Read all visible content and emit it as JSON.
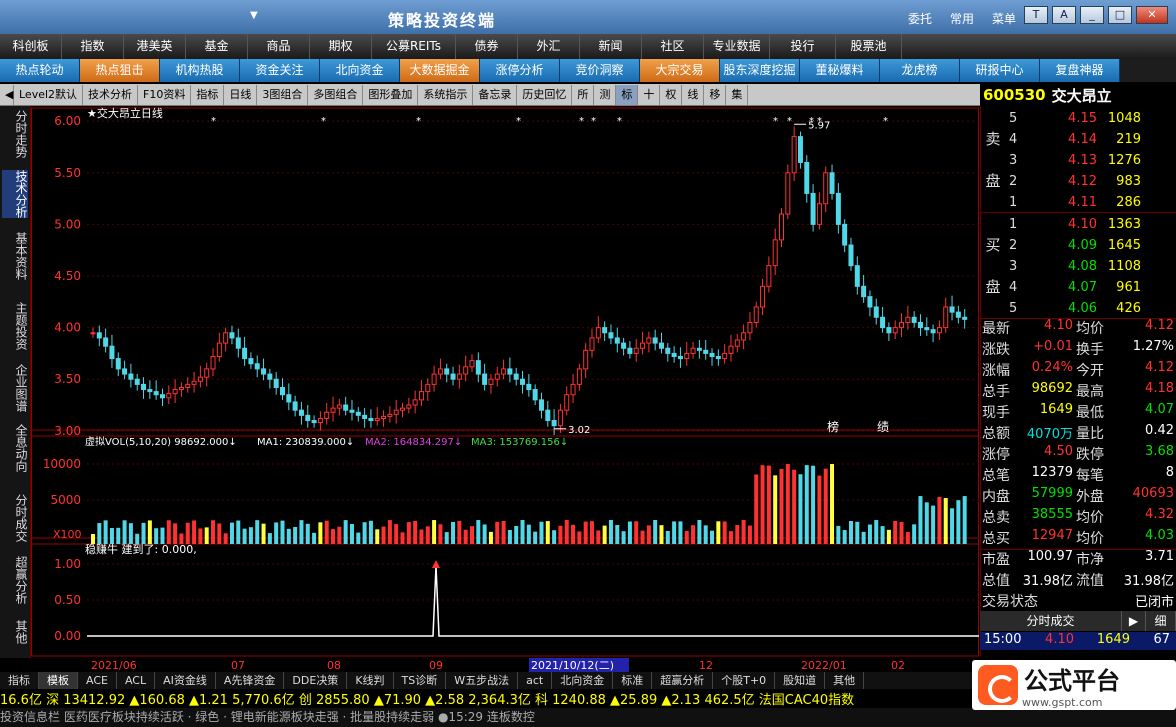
{
  "title": "策略投资终端",
  "titlebar_links": [
    "委托",
    "常用",
    "菜单"
  ],
  "menu1": [
    "科创板",
    "指数",
    "港美英",
    "基金",
    "商品",
    "期权",
    "公募REITs",
    "债券",
    "外汇",
    "新闻",
    "社区",
    "专业数据",
    "投行",
    "股票池"
  ],
  "menu2": [
    {
      "label": "热点轮动",
      "style": "blue"
    },
    {
      "label": "热点狙击",
      "style": "orange"
    },
    {
      "label": "机构热股",
      "style": "blue"
    },
    {
      "label": "资金关注",
      "style": "blue"
    },
    {
      "label": "北向资金",
      "style": "blue"
    },
    {
      "label": "大数据掘金",
      "style": "orange"
    },
    {
      "label": "涨停分析",
      "style": "blue"
    },
    {
      "label": "竞价洞察",
      "style": "blue"
    },
    {
      "label": "大宗交易",
      "style": "orange"
    },
    {
      "label": "股东深度挖掘",
      "style": "blue"
    },
    {
      "label": "董秘爆料",
      "style": "blue"
    },
    {
      "label": "龙虎榜",
      "style": "blue"
    },
    {
      "label": "研报中心",
      "style": "blue"
    },
    {
      "label": "复盘神器",
      "style": "blue"
    }
  ],
  "toolbar": [
    "Level2默认",
    "技术分析",
    "F10资料",
    "指标",
    "日线",
    "3图组合",
    "多图组合",
    "图形叠加",
    "系统指示",
    "备忘录",
    "历史回忆",
    "所",
    "测",
    "标",
    "十",
    "权",
    "线",
    "移",
    "集"
  ],
  "stock": {
    "code": "600530",
    "name": "交大昂立"
  },
  "left_tabs": [
    "分时走势",
    "技术分析",
    "基本资料",
    "主题投资",
    "企业图谱",
    "全息动向",
    "分时成交",
    "超赢分析",
    "其他"
  ],
  "chart_data": {
    "type": "candlestick",
    "title": "交大昂立日线",
    "y_ticks": [
      "6.00",
      "5.50",
      "5.00",
      "4.50",
      "4.00",
      "3.50",
      "3.00"
    ],
    "ylim": [
      2.95,
      6.05
    ],
    "high_label": "5.97",
    "low_label": "3.02",
    "annotations": [
      "榜",
      "绩"
    ],
    "closes": [
      3.95,
      3.9,
      3.82,
      3.7,
      3.6,
      3.55,
      3.5,
      3.45,
      3.4,
      3.38,
      3.35,
      3.32,
      3.36,
      3.4,
      3.42,
      3.45,
      3.48,
      3.52,
      3.6,
      3.72,
      3.85,
      3.95,
      3.9,
      3.8,
      3.7,
      3.65,
      3.6,
      3.55,
      3.5,
      3.42,
      3.35,
      3.28,
      3.2,
      3.15,
      3.1,
      3.08,
      3.12,
      3.18,
      3.22,
      3.25,
      3.2,
      3.18,
      3.15,
      3.12,
      3.1,
      3.12,
      3.14,
      3.16,
      3.2,
      3.22,
      3.25,
      3.3,
      3.38,
      3.45,
      3.55,
      3.6,
      3.55,
      3.5,
      3.55,
      3.62,
      3.68,
      3.55,
      3.45,
      3.5,
      3.55,
      3.6,
      3.55,
      3.5,
      3.45,
      3.4,
      3.3,
      3.2,
      3.1,
      3.05,
      3.2,
      3.35,
      3.45,
      3.6,
      3.78,
      3.9,
      4.0,
      3.95,
      3.9,
      3.85,
      3.8,
      3.75,
      3.8,
      3.85,
      3.9,
      3.85,
      3.8,
      3.75,
      3.72,
      3.7,
      3.75,
      3.8,
      3.78,
      3.75,
      3.72,
      3.7,
      3.75,
      3.82,
      3.88,
      3.95,
      4.05,
      4.2,
      4.4,
      4.6,
      4.85,
      5.1,
      5.5,
      5.85,
      5.6,
      5.3,
      5.0,
      5.2,
      5.5,
      5.3,
      5.0,
      4.8,
      4.6,
      4.4,
      4.3,
      4.2,
      4.1,
      4.0,
      3.95,
      4.0,
      4.05,
      4.1,
      4.05,
      4.0,
      3.98,
      3.95,
      4.0,
      4.2,
      4.15,
      4.1,
      4.08
    ],
    "indicator_vol": {
      "label": "虚拟VOL(5,10,20)",
      "value": "98692.000",
      "ma1_label": "MA1:",
      "ma1": "230839.000",
      "ma2_label": "MA2:",
      "ma2": "164834.297",
      "ma3_label": "MA3:",
      "ma3": "153769.156",
      "y_ticks": [
        "10000",
        "5000"
      ],
      "unit": "X100"
    },
    "indicator_ai": {
      "label": "稳赚牛",
      "text": "建到了: 0.000,",
      "y_ticks": [
        "1.00",
        "0.50",
        "0.00"
      ]
    },
    "date_labels": [
      "2021/06",
      "07",
      "08",
      "09",
      "2021/10/12(二)",
      "12",
      "2022/01",
      "02"
    ]
  },
  "orderbook": {
    "sell": [
      {
        "lv": "5",
        "price": "4.15",
        "vol": "1048"
      },
      {
        "lv": "4",
        "price": "4.14",
        "vol": "219"
      },
      {
        "lv": "3",
        "price": "4.13",
        "vol": "1276"
      },
      {
        "lv": "2",
        "price": "4.12",
        "vol": "983"
      },
      {
        "lv": "1",
        "price": "4.11",
        "vol": "286"
      }
    ],
    "buy": [
      {
        "lv": "1",
        "price": "4.10",
        "vol": "1363"
      },
      {
        "lv": "2",
        "price": "4.09",
        "vol": "1645"
      },
      {
        "lv": "3",
        "price": "4.08",
        "vol": "1108"
      },
      {
        "lv": "4",
        "price": "4.07",
        "vol": "961"
      },
      {
        "lv": "5",
        "price": "4.06",
        "vol": "426"
      }
    ],
    "sell_label": [
      "卖",
      "盘"
    ],
    "buy_label": [
      "买",
      "盘"
    ]
  },
  "info": [
    {
      "l1": "最新",
      "v1": "4.10",
      "c1": "red",
      "l2": "均价",
      "v2": "4.12",
      "c2": "red"
    },
    {
      "l1": "涨跌",
      "v1": "+0.01",
      "c1": "red",
      "l2": "换手",
      "v2": "1.27%",
      "c2": "white"
    },
    {
      "l1": "涨幅",
      "v1": "0.24%",
      "c1": "red",
      "l2": "今开",
      "v2": "4.12",
      "c2": "red"
    },
    {
      "l1": "总手",
      "v1": "98692",
      "c1": "yellow",
      "l2": "最高",
      "v2": "4.18",
      "c2": "red"
    },
    {
      "l1": "现手",
      "v1": "1649",
      "c1": "yellow",
      "l2": "最低",
      "v2": "4.07",
      "c2": "green"
    },
    {
      "l1": "总额",
      "v1": "4070万",
      "c1": "cyan",
      "l2": "量比",
      "v2": "0.42",
      "c2": "white"
    },
    {
      "l1": "涨停",
      "v1": "4.50",
      "c1": "red",
      "l2": "跌停",
      "v2": "3.68",
      "c2": "green"
    },
    {
      "l1": "总笔",
      "v1": "12379",
      "c1": "white",
      "l2": "每笔",
      "v2": "8",
      "c2": "white"
    },
    {
      "l1": "内盘",
      "v1": "57999",
      "c1": "green",
      "l2": "外盘",
      "v2": "40693",
      "c2": "red"
    },
    {
      "l1": "总卖",
      "v1": "38555",
      "c1": "green",
      "l2": "均价",
      "v2": "4.32",
      "c2": "red"
    },
    {
      "l1": "总买",
      "v1": "12947",
      "c1": "red",
      "l2": "均价",
      "v2": "4.03",
      "c2": "green"
    },
    {
      "l1": "市盈",
      "v1": "100.97",
      "c1": "white",
      "l2": "市净",
      "v2": "3.71",
      "c2": "white"
    },
    {
      "l1": "总值",
      "v1": "31.98亿",
      "c1": "white",
      "l2": "流值",
      "v2": "31.98亿",
      "c2": "white"
    },
    {
      "l1": "交易状态",
      "v1": "",
      "c1": "white",
      "l2": "",
      "v2": "已闭市",
      "c2": "white"
    }
  ],
  "panel_tabs": [
    "分时成交",
    "细"
  ],
  "last_trade": {
    "time": "15:00",
    "price": "4.10",
    "vol": "1649",
    "count": "67"
  },
  "bottom_tabs": [
    "指标",
    "模板",
    "ACE",
    "ACL",
    "AI资金线",
    "A先锋资金",
    "DDE决策",
    "K线判",
    "TS诊断",
    "W五步战法",
    "act",
    "北向资金",
    "标准",
    "超赢分析",
    "个股T+0",
    "股知道",
    "其他"
  ],
  "ticker": "16.6亿 深 13412.92 ▲160.68 ▲1.21 5,770.6亿 创 2855.80 ▲71.90 ▲2.58 2,364.3亿 科 1240.88 ▲25.89 ▲2.13 462.5亿 法国CAC40指数",
  "ticker2": "投资信息栏  医药医疗板块持续活跃  ·  绿色  ·  锂电新能源板块走强  ·  批量股持续走弱 ●15:29 连板数控",
  "logo_text": "公式平台",
  "logo_sub": "www.gspt.com"
}
